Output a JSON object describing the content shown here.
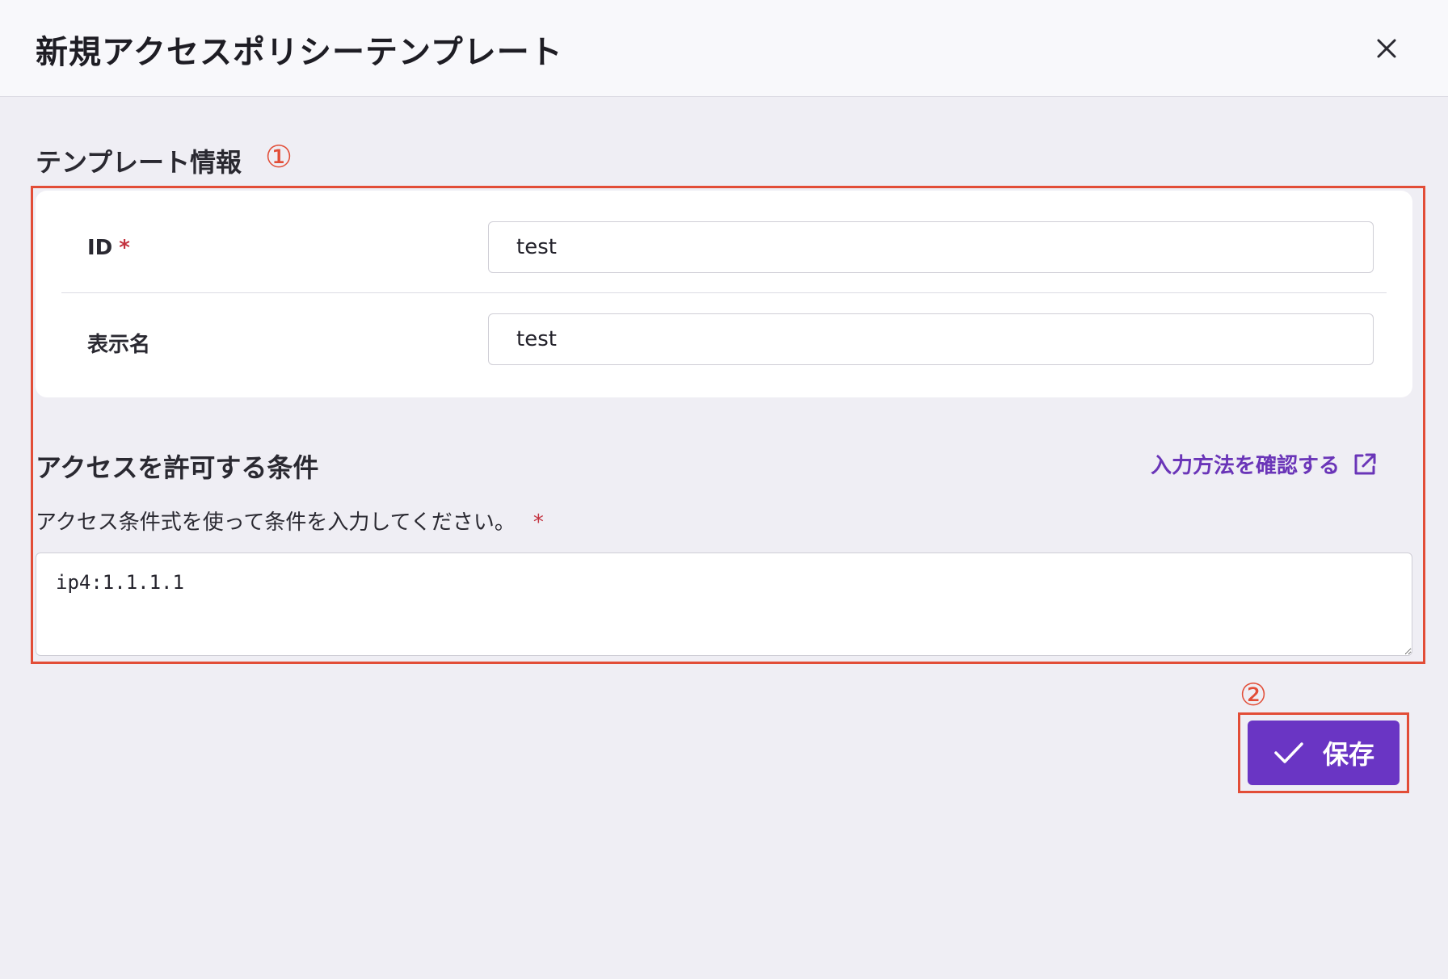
{
  "dialog": {
    "title": "新規アクセスポリシーテンプレート",
    "close_icon": "close-icon"
  },
  "template_info": {
    "section_title": "テンプレート情報",
    "annotation": "①",
    "id_label": "ID",
    "required_mark": "*",
    "id_value": "test",
    "display_name_label": "表示名",
    "display_name_value": "test"
  },
  "conditions": {
    "section_title": "アクセスを許可する条件",
    "help_link": "入力方法を確認する",
    "help_icon": "external-link-icon",
    "description": "アクセス条件式を使って条件を入力してください。",
    "required_mark": "*",
    "expression": "ip4:1.1.1.1"
  },
  "actions": {
    "annotation": "②",
    "save_label": "保存",
    "save_icon": "checkmark-icon"
  },
  "colors": {
    "primary": "#6a35c4",
    "link": "#6a35b8",
    "annotation": "#e24d37",
    "required": "#c3323f",
    "background": "#efeef4"
  }
}
